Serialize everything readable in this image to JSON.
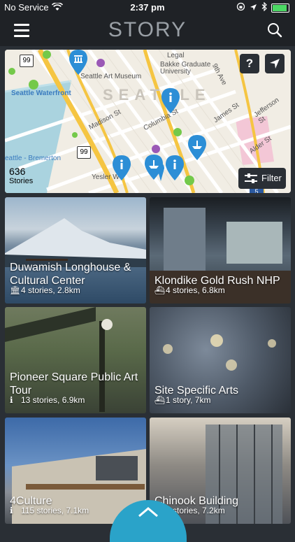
{
  "status": {
    "carrier": "No Service",
    "time": "2:37 pm"
  },
  "header": {
    "logo": "STORY"
  },
  "map": {
    "labels": {
      "museum": "Seattle Art Museum",
      "waterfront": "Seattle Waterfront",
      "bremerton": "eattle - Bremerton",
      "madison": "Madison St",
      "columbia": "Columbia St",
      "james": "James St",
      "jefferson": "Jefferson St",
      "alder": "Alder St",
      "ninth": "9th Ave",
      "bakke": "Bakke Graduate University",
      "legal": "Legal",
      "yesler": "Yesler W",
      "city": "SEATTLE",
      "route99a": "99",
      "route99b": "99",
      "route5": "5"
    },
    "stories_count": "636",
    "stories_label": "Stories",
    "help_label": "?",
    "filter_label": "Filter",
    "colors": {
      "pin": "#2c8ed6",
      "green_dot": "#74c94a"
    }
  },
  "tiles": [
    {
      "title": "Duwamish Longhouse & Cultural Center",
      "meta": "4 stories, 2.8km",
      "icon": "museum-icon"
    },
    {
      "title": "Klondike Gold Rush NHP",
      "meta": "4 stories, 6.8km",
      "icon": "boat-icon"
    },
    {
      "title": "Pioneer Square Public Art Tour",
      "meta": "13 stories, 6.9km",
      "icon": "info-icon"
    },
    {
      "title": "Site Specific Arts",
      "meta": "1 story, 7km",
      "icon": "boat-icon"
    },
    {
      "title": "4Culture",
      "meta": "115 stories, 7.1km",
      "icon": "info-icon"
    },
    {
      "title": "Chinook Building",
      "meta": "3 stories, 7.2km",
      "icon": "info-icon"
    }
  ]
}
